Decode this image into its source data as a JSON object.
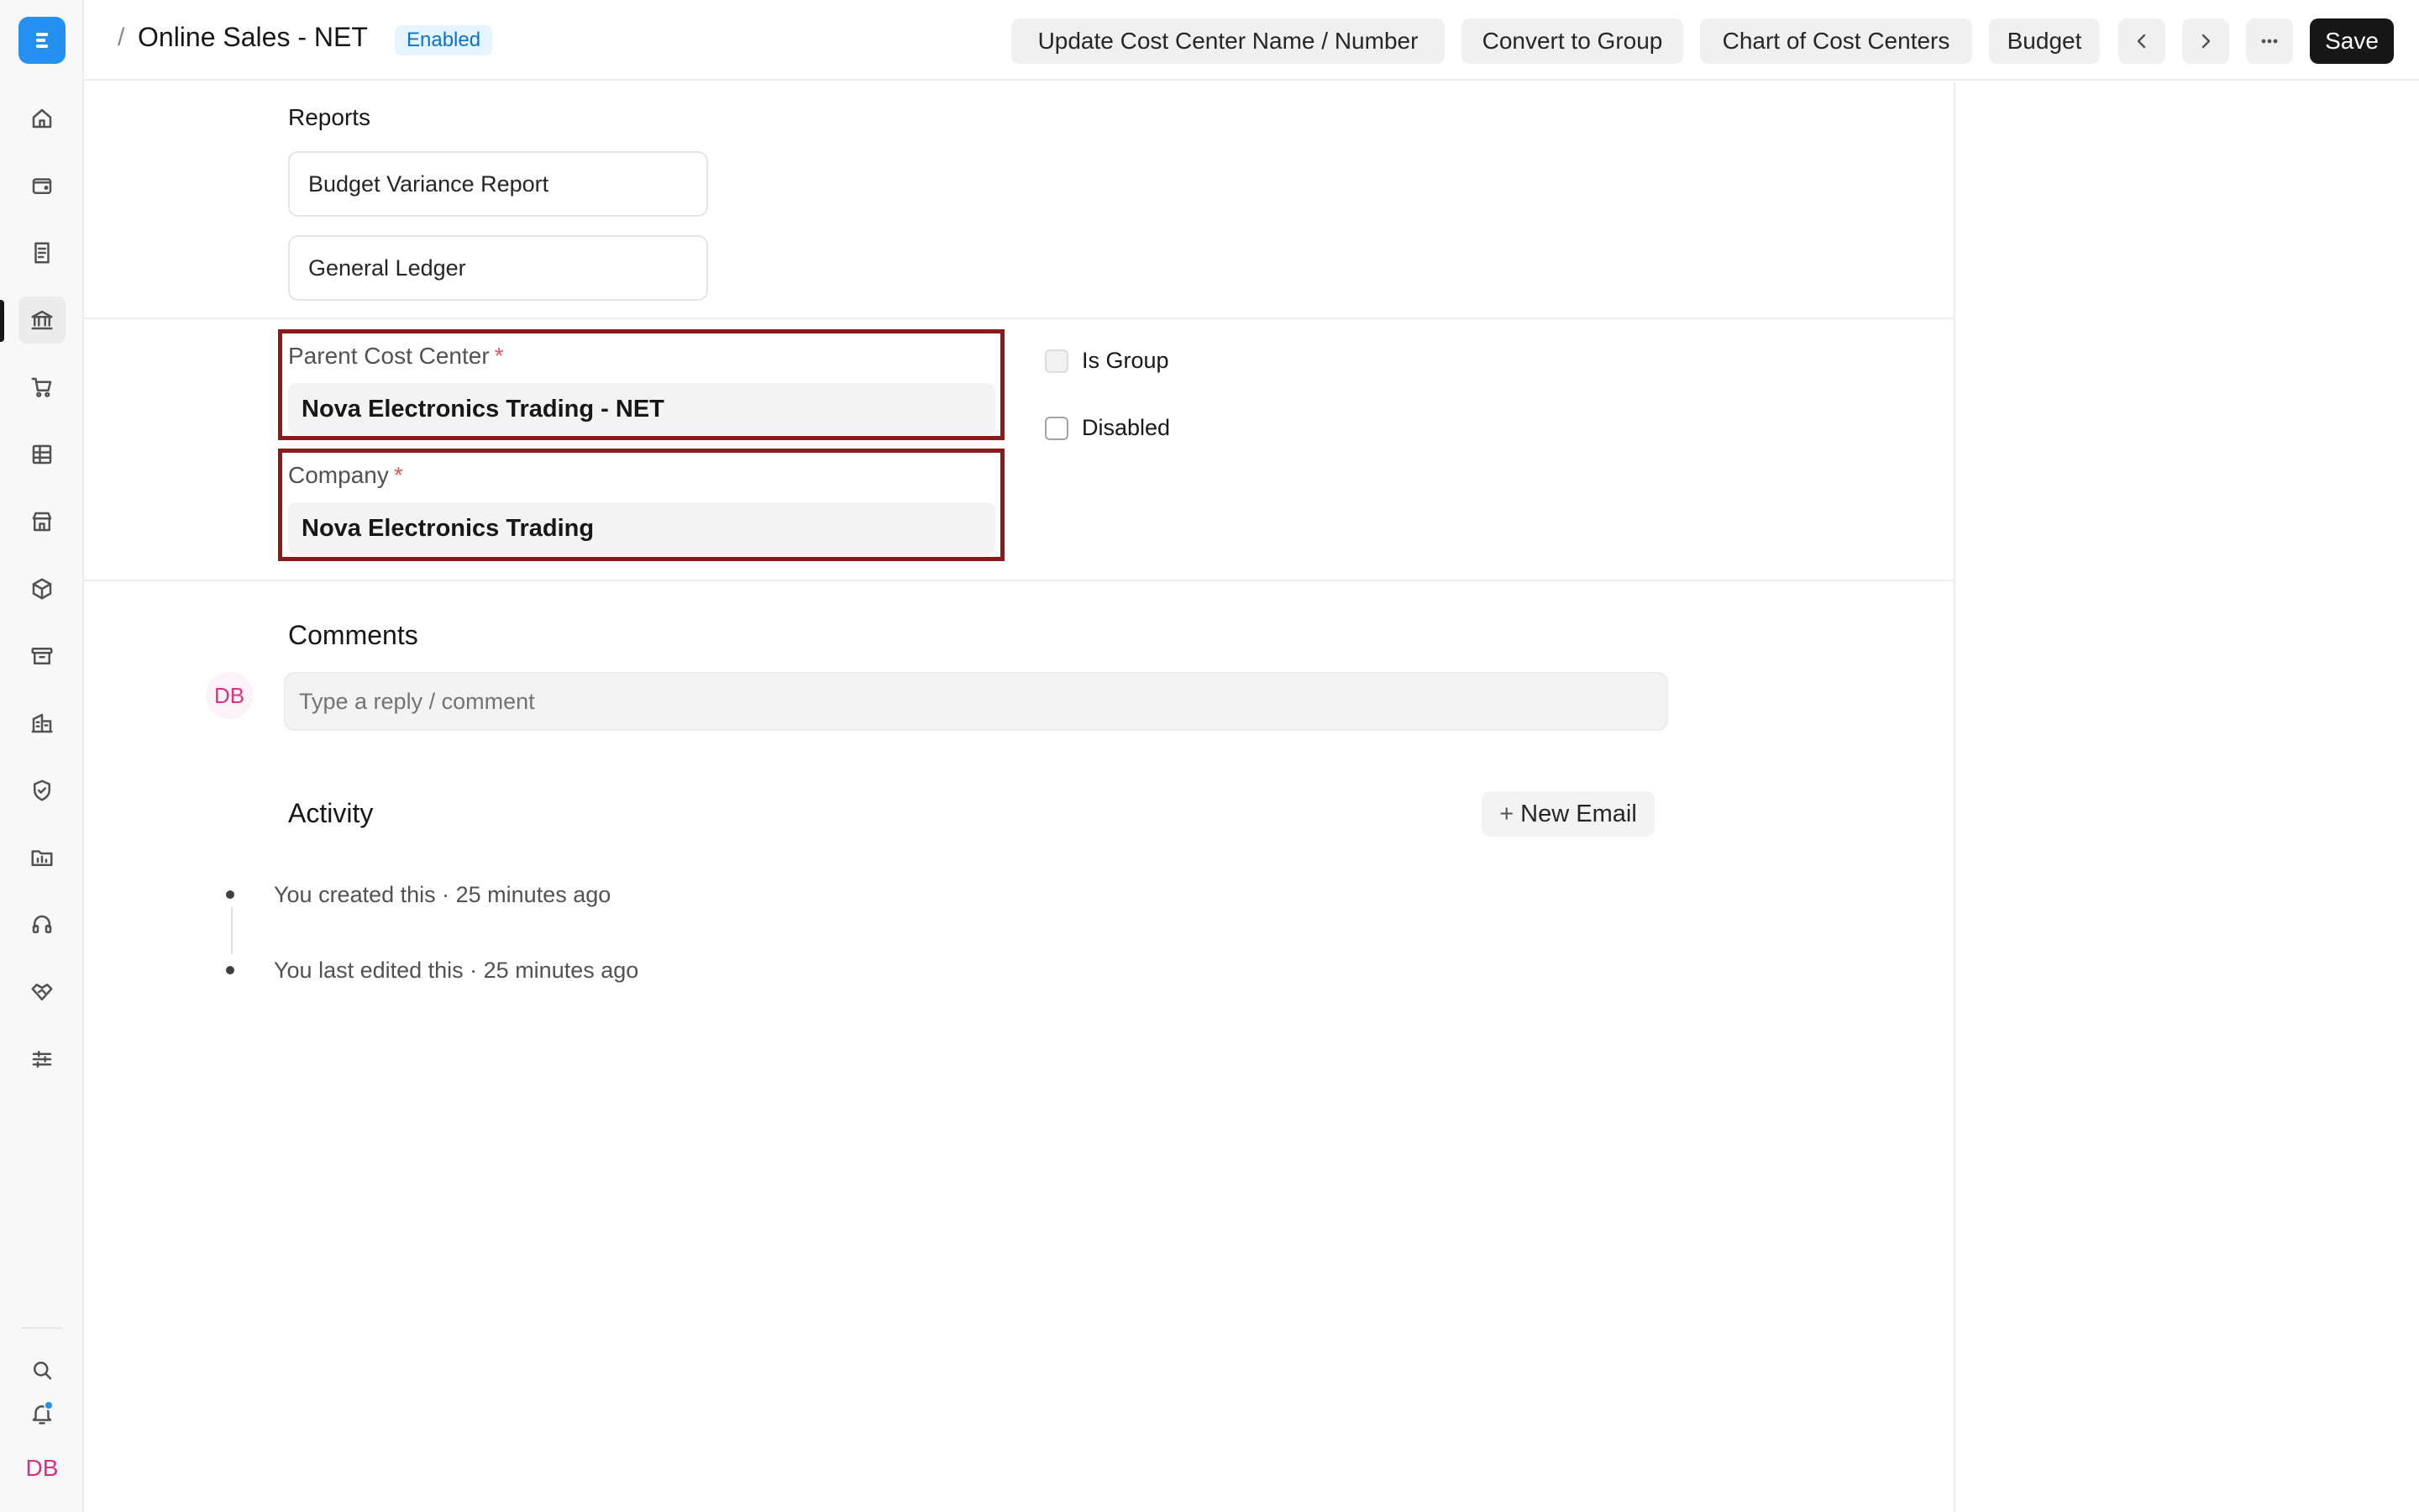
{
  "header": {
    "breadcrumb_separator": "/",
    "title": "Online Sales - NET",
    "status": "Enabled",
    "buttons": {
      "update_name": "Update Cost Center Name / Number",
      "convert_group": "Convert to Group",
      "chart": "Chart of Cost Centers",
      "budget": "Budget",
      "save": "Save"
    }
  },
  "sidebar": {
    "items": [
      "home-icon",
      "wallet-icon",
      "invoice-icon",
      "bank-icon",
      "cart-icon",
      "table-icon",
      "store-icon",
      "box-icon",
      "archive-icon",
      "building-icon",
      "shield-icon",
      "folder-icon",
      "headset-icon",
      "handshake-icon",
      "settings-sliders-icon"
    ],
    "active": "bank-icon",
    "user_initials": "DB"
  },
  "reports": {
    "label": "Reports",
    "links": [
      "Budget Variance Report",
      "General Ledger"
    ]
  },
  "form": {
    "parent_cost_center": {
      "label": "Parent Cost Center",
      "required": "*",
      "value": "Nova Electronics Trading - NET"
    },
    "company": {
      "label": "Company",
      "required": "*",
      "value": "Nova Electronics Trading"
    },
    "is_group": {
      "label": "Is Group",
      "checked": false,
      "disabled": true
    },
    "disabled": {
      "label": "Disabled",
      "checked": false
    }
  },
  "comments": {
    "heading": "Comments",
    "avatar": "DB",
    "placeholder": "Type a reply / comment"
  },
  "activity": {
    "heading": "Activity",
    "new_email": "New Email",
    "new_email_icon": "+",
    "entries": [
      "You created this · 25 minutes ago",
      "You last edited this · 25 minutes ago"
    ]
  },
  "colors": {
    "accent": "#2490ef",
    "highlight_border": "#8b1a1a",
    "avatar_text": "#d63384"
  }
}
